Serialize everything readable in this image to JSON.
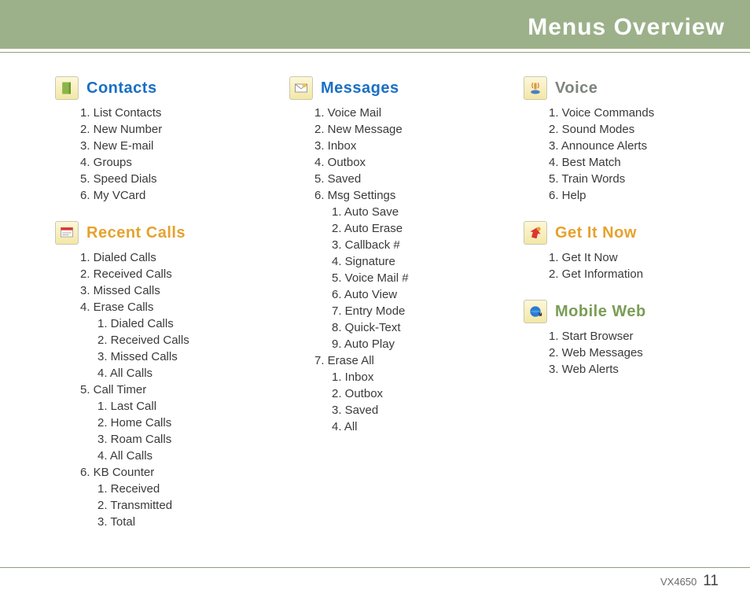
{
  "header": {
    "title": "Menus Overview"
  },
  "footer": {
    "model": "VX4650",
    "page": "11"
  },
  "sections": {
    "contacts": {
      "title": "Contacts",
      "items": [
        "List Contacts",
        "New Number",
        "New E-mail",
        "Groups",
        "Speed Dials",
        "My VCard"
      ]
    },
    "recent_calls": {
      "title": "Recent Calls",
      "items": [
        {
          "label": "Dialed Calls"
        },
        {
          "label": "Received Calls"
        },
        {
          "label": "Missed Calls"
        },
        {
          "label": "Erase Calls",
          "sub": [
            "Dialed Calls",
            "Received Calls",
            "Missed Calls",
            "All Calls"
          ]
        },
        {
          "label": "Call Timer",
          "sub": [
            "Last Call",
            "Home Calls",
            "Roam Calls",
            "All Calls"
          ]
        },
        {
          "label": "KB Counter",
          "sub": [
            "Received",
            "Transmitted",
            "Total"
          ]
        }
      ]
    },
    "messages": {
      "title": "Messages",
      "items": [
        {
          "label": "Voice Mail"
        },
        {
          "label": "New Message"
        },
        {
          "label": "Inbox"
        },
        {
          "label": "Outbox"
        },
        {
          "label": "Saved"
        },
        {
          "label": "Msg Settings",
          "sub": [
            "Auto Save",
            "Auto Erase",
            "Callback #",
            "Signature",
            "Voice Mail #",
            "Auto View",
            "Entry Mode",
            "Quick-Text",
            "Auto Play"
          ]
        },
        {
          "label": "Erase All",
          "sub": [
            "Inbox",
            "Outbox",
            "Saved",
            "All"
          ]
        }
      ]
    },
    "voice": {
      "title": "Voice",
      "items": [
        "Voice Commands",
        "Sound Modes",
        "Announce Alerts",
        "Best Match",
        "Train Words",
        "Help"
      ]
    },
    "get_it_now": {
      "title": "Get It Now",
      "items": [
        "Get It Now",
        "Get Information"
      ]
    },
    "mobile_web": {
      "title": "Mobile Web",
      "items": [
        "Start Browser",
        "Web Messages",
        "Web Alerts"
      ]
    }
  }
}
